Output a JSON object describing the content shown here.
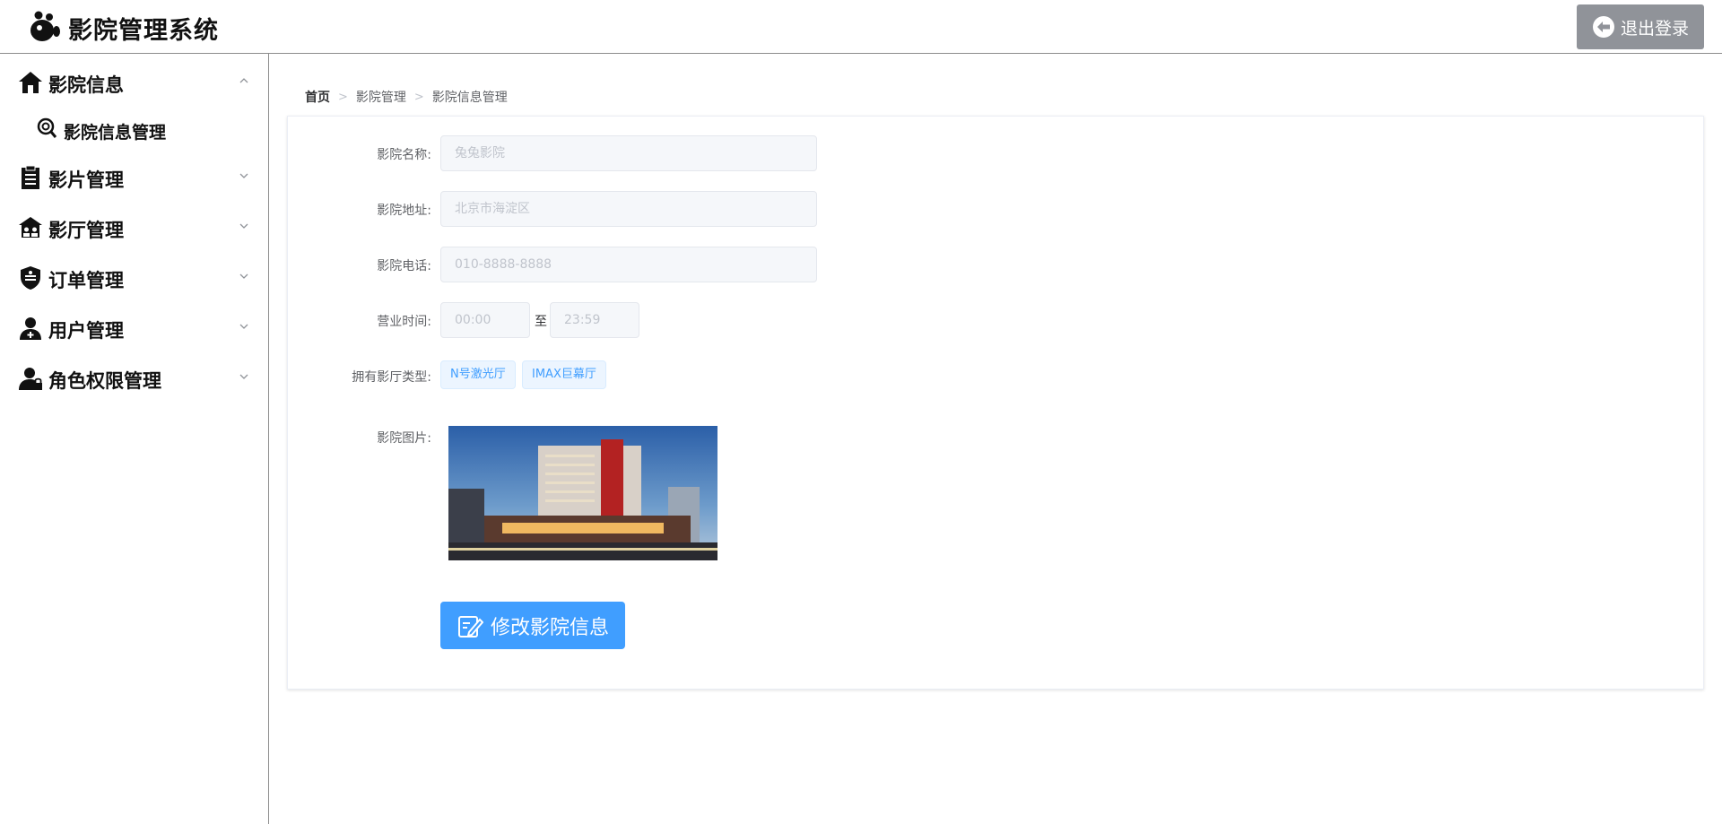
{
  "header": {
    "app_title": "影院管理系统",
    "logout_label": "退出登录"
  },
  "sidebar": {
    "items": [
      {
        "label": "影院信息",
        "icon": "home-icon",
        "expanded": true
      },
      {
        "label": "影片管理",
        "icon": "clipboard-icon",
        "expanded": false
      },
      {
        "label": "影厅管理",
        "icon": "hall-icon",
        "expanded": false
      },
      {
        "label": "订单管理",
        "icon": "shield-icon",
        "expanded": false
      },
      {
        "label": "用户管理",
        "icon": "user-icon",
        "expanded": false
      },
      {
        "label": "角色权限管理",
        "icon": "user-lock-icon",
        "expanded": false
      }
    ],
    "sub_items": [
      {
        "label": "影院信息管理",
        "icon": "search-icon"
      }
    ]
  },
  "breadcrumb": [
    "首页",
    "影院管理",
    "影院信息管理"
  ],
  "form": {
    "name_label": "影院名称:",
    "name_placeholder": "兔兔影院",
    "address_label": "影院地址:",
    "address_placeholder": "北京市海淀区",
    "phone_label": "影院电话:",
    "phone_placeholder": "010-8888-8888",
    "hours_label": "营业时间:",
    "hours_start": "00:00",
    "hours_sep": "至",
    "hours_end": "23:59",
    "hall_types_label": "拥有影厅类型:",
    "hall_types": [
      "N号激光厅",
      "IMAX巨幕厅"
    ],
    "image_label": "影院图片:",
    "edit_button": "修改影院信息"
  },
  "colors": {
    "primary": "#409eff",
    "logout_bg": "#909399",
    "tag_bg": "#ecf5ff",
    "tag_text": "#409eff"
  }
}
